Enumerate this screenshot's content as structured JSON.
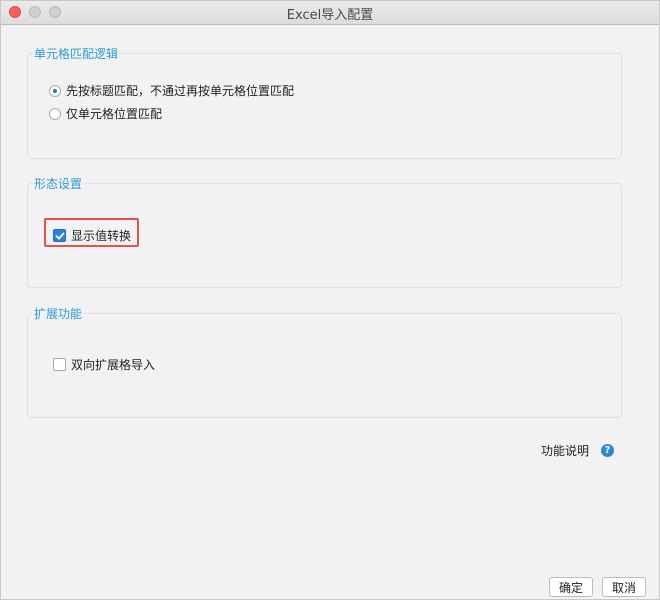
{
  "window": {
    "title": "Excel导入配置"
  },
  "groups": {
    "cell_match": {
      "title": "单元格匹配逻辑",
      "options": [
        {
          "label": "先按标题匹配，不通过再按单元格位置匹配",
          "selected": true
        },
        {
          "label": "仅单元格位置匹配",
          "selected": false
        }
      ]
    },
    "form_settings": {
      "title": "形态设置",
      "display_value_conversion": {
        "label": "显示值转换",
        "checked": true
      }
    },
    "extensions": {
      "title": "扩展功能",
      "bidirectional_expand_import": {
        "label": "双向扩展格导入",
        "checked": false
      }
    }
  },
  "help": {
    "label": "功能说明",
    "icon": "?"
  },
  "footer": {
    "ok_label": "确定",
    "cancel_label": "取消"
  },
  "colors": {
    "accent": "#2b9bd5",
    "checkbox_blue": "#2d7fe6",
    "highlight_red": "#e0554a"
  }
}
